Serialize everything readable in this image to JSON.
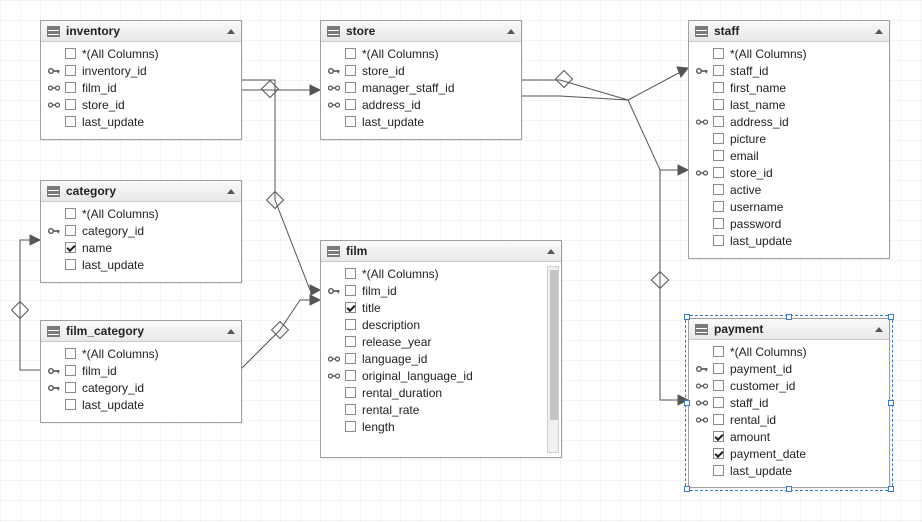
{
  "allColumnsLabel": "*(All Columns)",
  "tables": {
    "inventory": {
      "title": "inventory",
      "columns": [
        {
          "name": "*(All Columns)",
          "checked": false,
          "icon": ""
        },
        {
          "name": "inventory_id",
          "checked": false,
          "icon": "pk"
        },
        {
          "name": "film_id",
          "checked": false,
          "icon": "fk"
        },
        {
          "name": "store_id",
          "checked": false,
          "icon": "fk"
        },
        {
          "name": "last_update",
          "checked": false,
          "icon": ""
        }
      ]
    },
    "store": {
      "title": "store",
      "columns": [
        {
          "name": "*(All Columns)",
          "checked": false,
          "icon": ""
        },
        {
          "name": "store_id",
          "checked": false,
          "icon": "pk"
        },
        {
          "name": "manager_staff_id",
          "checked": false,
          "icon": "fk"
        },
        {
          "name": "address_id",
          "checked": false,
          "icon": "fk"
        },
        {
          "name": "last_update",
          "checked": false,
          "icon": ""
        }
      ]
    },
    "staff": {
      "title": "staff",
      "columns": [
        {
          "name": "*(All Columns)",
          "checked": false,
          "icon": ""
        },
        {
          "name": "staff_id",
          "checked": false,
          "icon": "pk"
        },
        {
          "name": "first_name",
          "checked": false,
          "icon": ""
        },
        {
          "name": "last_name",
          "checked": false,
          "icon": ""
        },
        {
          "name": "address_id",
          "checked": false,
          "icon": "fk"
        },
        {
          "name": "picture",
          "checked": false,
          "icon": ""
        },
        {
          "name": "email",
          "checked": false,
          "icon": ""
        },
        {
          "name": "store_id",
          "checked": false,
          "icon": "fk"
        },
        {
          "name": "active",
          "checked": false,
          "icon": ""
        },
        {
          "name": "username",
          "checked": false,
          "icon": ""
        },
        {
          "name": "password",
          "checked": false,
          "icon": ""
        },
        {
          "name": "last_update",
          "checked": false,
          "icon": ""
        }
      ]
    },
    "category": {
      "title": "category",
      "columns": [
        {
          "name": "*(All Columns)",
          "checked": false,
          "icon": ""
        },
        {
          "name": "category_id",
          "checked": false,
          "icon": "pk"
        },
        {
          "name": "name",
          "checked": true,
          "icon": ""
        },
        {
          "name": "last_update",
          "checked": false,
          "icon": ""
        }
      ]
    },
    "film_category": {
      "title": "film_category",
      "columns": [
        {
          "name": "*(All Columns)",
          "checked": false,
          "icon": ""
        },
        {
          "name": "film_id",
          "checked": false,
          "icon": "pk"
        },
        {
          "name": "category_id",
          "checked": false,
          "icon": "pk"
        },
        {
          "name": "last_update",
          "checked": false,
          "icon": ""
        }
      ]
    },
    "film": {
      "title": "film",
      "columns": [
        {
          "name": "*(All Columns)",
          "checked": false,
          "icon": ""
        },
        {
          "name": "film_id",
          "checked": false,
          "icon": "pk"
        },
        {
          "name": "title",
          "checked": true,
          "icon": ""
        },
        {
          "name": "description",
          "checked": false,
          "icon": ""
        },
        {
          "name": "release_year",
          "checked": false,
          "icon": ""
        },
        {
          "name": "language_id",
          "checked": false,
          "icon": "fk"
        },
        {
          "name": "original_language_id",
          "checked": false,
          "icon": "fk"
        },
        {
          "name": "rental_duration",
          "checked": false,
          "icon": ""
        },
        {
          "name": "rental_rate",
          "checked": false,
          "icon": ""
        },
        {
          "name": "length",
          "checked": false,
          "icon": ""
        }
      ]
    },
    "payment": {
      "title": "payment",
      "columns": [
        {
          "name": "*(All Columns)",
          "checked": false,
          "icon": ""
        },
        {
          "name": "payment_id",
          "checked": false,
          "icon": "pk"
        },
        {
          "name": "customer_id",
          "checked": false,
          "icon": "fk"
        },
        {
          "name": "staff_id",
          "checked": false,
          "icon": "fk"
        },
        {
          "name": "rental_id",
          "checked": false,
          "icon": "fk"
        },
        {
          "name": "amount",
          "checked": true,
          "icon": ""
        },
        {
          "name": "payment_date",
          "checked": true,
          "icon": ""
        },
        {
          "name": "last_update",
          "checked": false,
          "icon": ""
        }
      ]
    }
  }
}
